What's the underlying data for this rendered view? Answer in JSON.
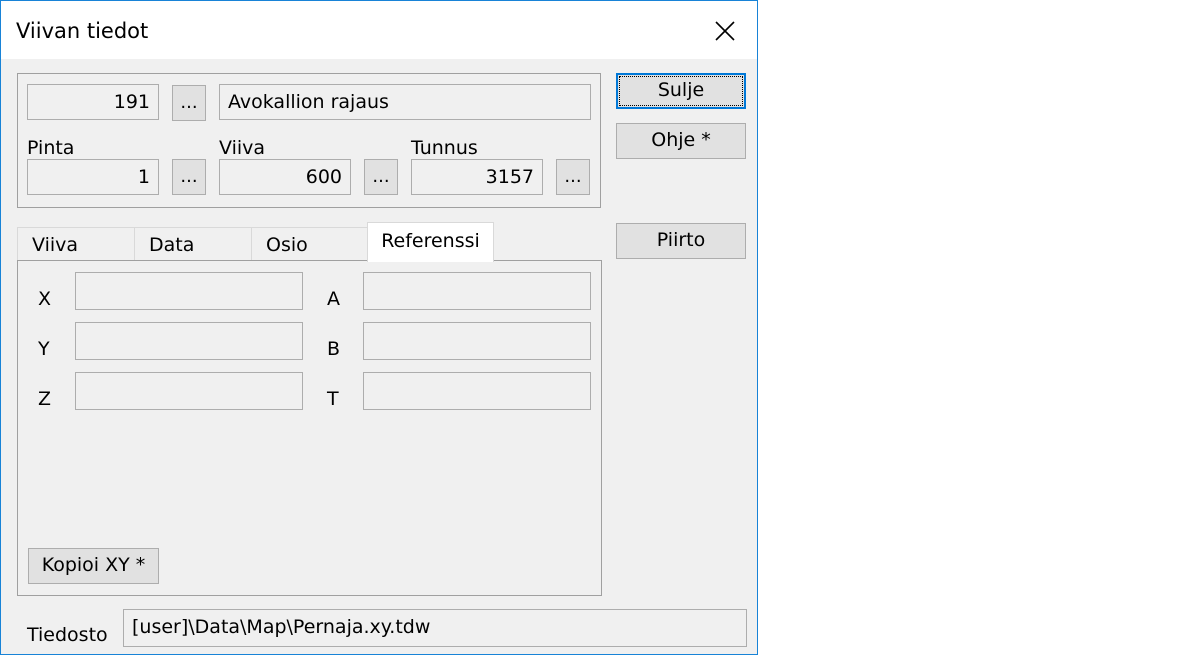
{
  "window": {
    "title": "Viivan tiedot"
  },
  "header": {
    "id_value": "191",
    "name_value": "Avokallion rajaus",
    "pinta": {
      "label": "Pinta",
      "value": "1"
    },
    "viiva": {
      "label": "Viiva",
      "value": "600"
    },
    "tunnus": {
      "label": "Tunnus",
      "value": "3157"
    },
    "browse_label": "..."
  },
  "buttons": {
    "sulje": "Sulje",
    "ohje": "Ohje *",
    "piirto": "Piirto"
  },
  "tabs": [
    {
      "label": "Viiva",
      "active": false
    },
    {
      "label": "Data",
      "active": false
    },
    {
      "label": "Osio",
      "active": false
    },
    {
      "label": "Referenssi",
      "active": true
    }
  ],
  "reference": {
    "x": {
      "label": "X",
      "value": ""
    },
    "y": {
      "label": "Y",
      "value": ""
    },
    "z": {
      "label": "Z",
      "value": ""
    },
    "a": {
      "label": "A",
      "value": ""
    },
    "b": {
      "label": "B",
      "value": ""
    },
    "t": {
      "label": "T",
      "value": ""
    },
    "copy_button": "Kopioi XY *"
  },
  "file": {
    "label": "Tiedosto",
    "path": "[user]\\Data\\Map\\Pernaja.xy.tdw"
  },
  "icons": {
    "close": "close-icon"
  },
  "colors": {
    "accent": "#0078d7",
    "window_border": "#1883d7",
    "face": "#f0f0f0"
  }
}
